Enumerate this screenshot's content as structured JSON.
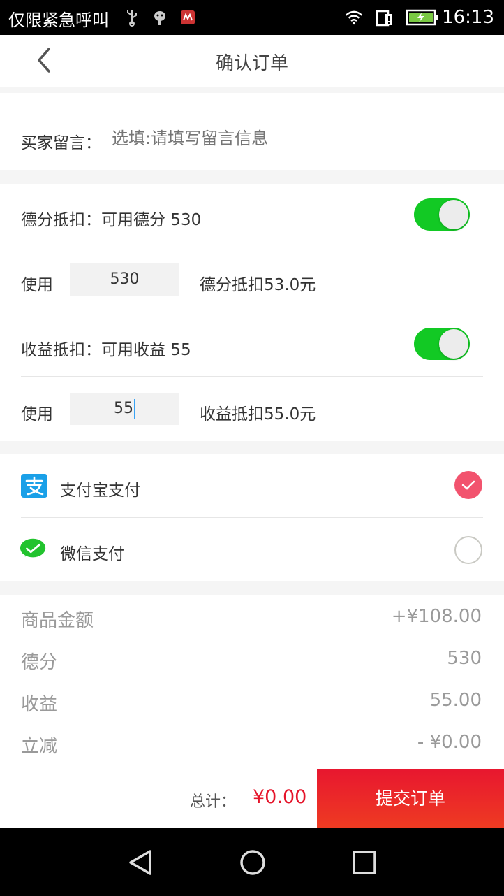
{
  "status_bar": {
    "carrier": "仅限紧急呼叫",
    "time": "16:13",
    "icons": [
      "usb-icon",
      "android-debug-icon",
      "notification-icon",
      "wifi-icon",
      "sim-alert-icon",
      "battery-charging-icon"
    ]
  },
  "header": {
    "title": "确认订单"
  },
  "message": {
    "label": "买家留言：",
    "placeholder": "选填:请填写留言信息"
  },
  "defen": {
    "label": "德分抵扣：可用德分 530",
    "toggle_on": true,
    "use_label": "使用",
    "input_value": "530",
    "deduct_text": "德分抵扣53.0元"
  },
  "income": {
    "label": "收益抵扣：可用收益 55",
    "toggle_on": true,
    "use_label": "使用",
    "input_value": "55",
    "deduct_text": "收益抵扣55.0元"
  },
  "payment": {
    "options": [
      {
        "label": "支付宝支付",
        "icon": "alipay-icon",
        "selected": true
      },
      {
        "label": "微信支付",
        "icon": "wechat-icon",
        "selected": false
      }
    ]
  },
  "summary": {
    "rows": [
      {
        "label": "商品金额",
        "value": "+¥108.00"
      },
      {
        "label": "德分",
        "value": "530"
      },
      {
        "label": "收益",
        "value": "55.00"
      },
      {
        "label": "立减",
        "value": "- ¥0.00"
      }
    ]
  },
  "footer": {
    "total_label": "总计：",
    "total_value": "¥0.00",
    "submit_label": "提交订单"
  },
  "colors": {
    "accent_red": "#e5142a",
    "toggle_green": "#12c924",
    "radio_pink": "#f2536e",
    "alipay_blue": "#1aa0e8",
    "wechat_green": "#22c32e"
  }
}
